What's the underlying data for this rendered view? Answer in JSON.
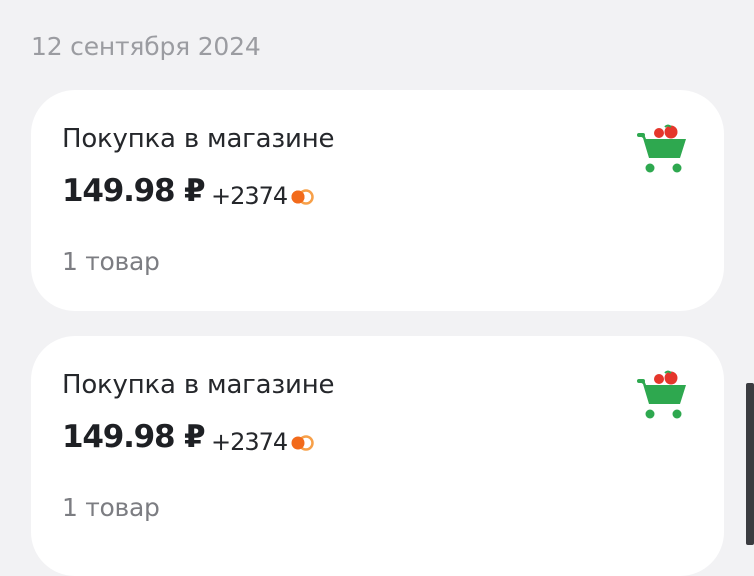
{
  "date_header": "12 сентября 2024",
  "purchases": [
    {
      "title": "Покупка в магазине",
      "amount": "149.98 ₽",
      "bonus": "+2374",
      "items": "1 товар",
      "icon": "shopping-cart-icon"
    },
    {
      "title": "Покупка в магазине",
      "amount": "149.98 ₽",
      "bonus": "+2374",
      "items": "1 товар",
      "icon": "shopping-cart-icon"
    }
  ],
  "colors": {
    "cart_green": "#2ea84f",
    "cart_produce_red": "#e5362b",
    "bonus_orange": "#f26a1b",
    "background": "#f2f2f4"
  }
}
